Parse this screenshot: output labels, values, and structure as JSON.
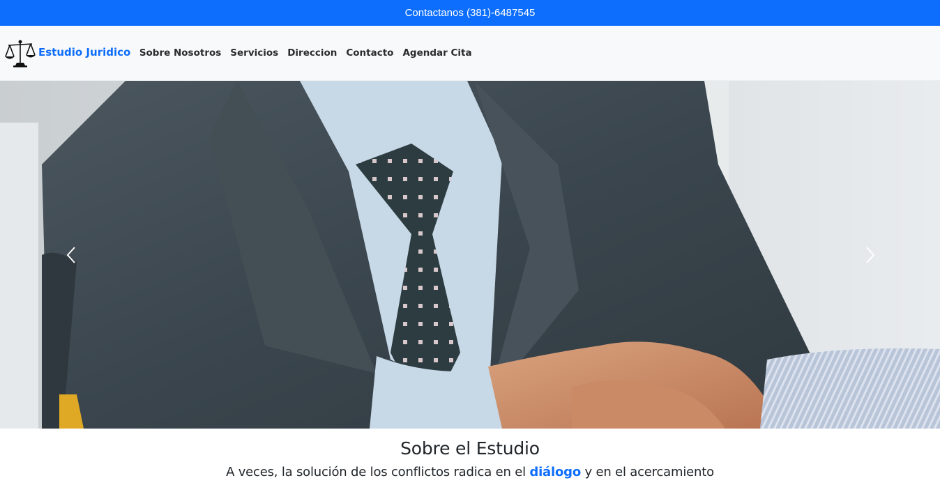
{
  "topbar": {
    "contact_text": "Contactanos (381)-6487545"
  },
  "navbar": {
    "brand": "Estudio Juridico",
    "brand_icon": "scales-of-justice-icon",
    "links": [
      "Sobre Nosotros",
      "Servicios",
      "Direccion",
      "Contacto",
      "Agendar Cita"
    ]
  },
  "carousel": {
    "prev_icon": "chevron-left-icon",
    "next_icon": "chevron-right-icon"
  },
  "about": {
    "title": "Sobre el Estudio",
    "text_before": "A veces, la solución de los conflictos radica en el ",
    "text_highlight": "diálogo",
    "text_after": " y en el acercamiento"
  },
  "colors": {
    "primary": "#0d6efd",
    "navbar_bg": "#f8f9fa"
  }
}
